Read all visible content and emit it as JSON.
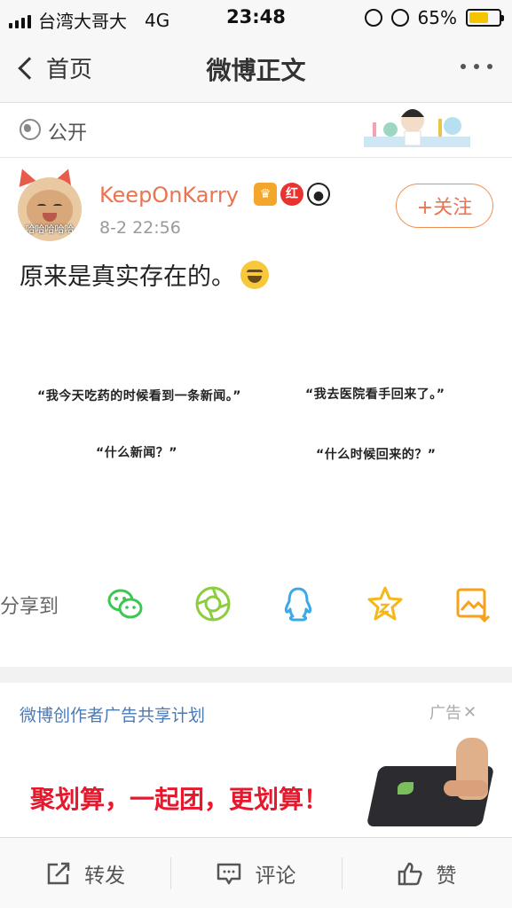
{
  "status_bar": {
    "carrier": "台湾大哥大",
    "network": "4G",
    "time": "23:48",
    "battery_percent": "65%",
    "battery_level": 0.65
  },
  "nav": {
    "back_label": "首页",
    "title": "微博正文"
  },
  "privacy": {
    "label": "公开"
  },
  "post": {
    "username": "KeepOnKarry",
    "badges": [
      "crown-icon",
      "red-badge-icon",
      "panda-icon"
    ],
    "badge_red_text": "红",
    "avatar_caption": "哈哈哈哈哈",
    "timestamp": "8-2 22:56",
    "follow_label": "+关注",
    "text": "原来是真实存在的。",
    "comic_lines": [
      "“我今天吃药的时候看到一条新闻。”",
      "“什么新闻？”",
      "“我去医院看手回来了。”",
      "“什么时候回来的？”"
    ]
  },
  "share": {
    "label": "分享到",
    "targets": [
      "wechat-icon",
      "moments-icon",
      "qq-icon",
      "favorite-icon",
      "save-image-icon"
    ]
  },
  "ad": {
    "plan_label": "微博创作者广告共享计划",
    "tag_label": "广告",
    "headline": "聚划算，一起团，更划算！"
  },
  "actions": {
    "repost": "转发",
    "comment": "评论",
    "like": "赞"
  },
  "colors": {
    "accent_orange": "#eb7350",
    "link_blue": "#4a7ab6",
    "ad_red": "#e8172c",
    "wechat_green": "#3cc654",
    "qq_blue": "#3da8e8",
    "star_yellow": "#f6b71a"
  }
}
